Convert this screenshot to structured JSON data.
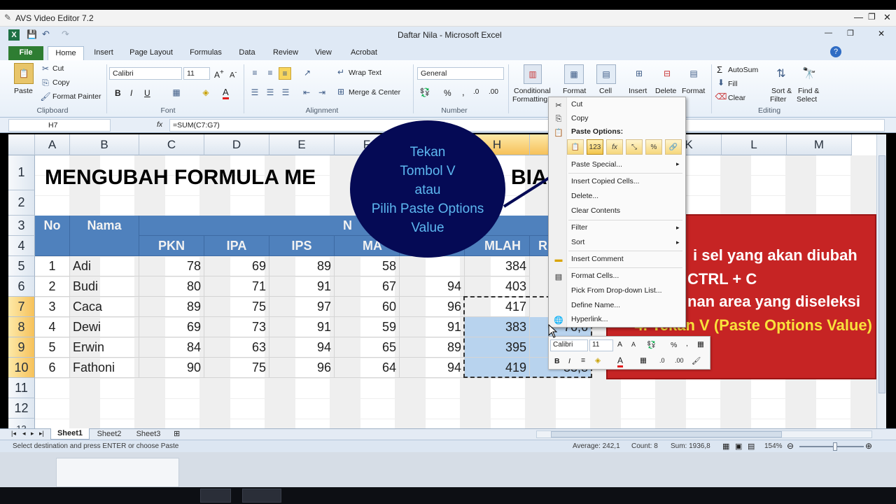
{
  "outer_window": {
    "title": "AVS Video Editor 7.2"
  },
  "excel": {
    "title": "Daftar Nila  -  Microsoft Excel",
    "tabs": [
      "File",
      "Home",
      "Insert",
      "Page Layout",
      "Formulas",
      "Data",
      "Review",
      "View",
      "Acrobat"
    ],
    "active_tab": "Home"
  },
  "ribbon": {
    "clipboard": {
      "paste": "Paste",
      "cut": "Cut",
      "copy": "Copy",
      "format_painter": "Format Painter",
      "label": "Clipboard"
    },
    "font": {
      "name": "Calibri",
      "size": "11",
      "bold": "B",
      "italic": "I",
      "underline": "U",
      "label": "Font"
    },
    "alignment": {
      "wrap": "Wrap Text",
      "merge": "Merge & Center",
      "label": "Alignment"
    },
    "number": {
      "format": "General",
      "percent": "%",
      "comma": ",",
      "label": "Number"
    },
    "styles": {
      "conditional_1": "Conditional",
      "conditional_2": "Formatting",
      "format_1": "Format",
      "cell": "Cell"
    },
    "cells": {
      "insert": "Insert",
      "delete": "Delete",
      "format": "Format"
    },
    "editing": {
      "autosum": "AutoSum",
      "fill": "Fill",
      "clear": "Clear",
      "sort_1": "Sort &",
      "sort_2": "Filter",
      "find_1": "Find &",
      "find_2": "Select",
      "label": "Editing"
    }
  },
  "formula_bar": {
    "name_box": "H7",
    "fx": "fx",
    "formula": "=SUM(C7:G7)"
  },
  "columns": [
    "A",
    "B",
    "C",
    "D",
    "E",
    "F",
    "G",
    "H",
    "I",
    "J",
    "K",
    "L",
    "M"
  ],
  "sheet": {
    "title": "MENGUBAH FORMULA ME",
    "title_tail": "BIA",
    "headers": {
      "no": "No",
      "nama": "Nama",
      "nilai": "N",
      "pkn": "PKN",
      "ipa": "IPA",
      "ips": "IPS",
      "mat": "MA",
      "jumlah": "MLAH",
      "rata": "R"
    },
    "rows": [
      {
        "no": "1",
        "nama": "Adi",
        "pkn": "78",
        "ipa": "69",
        "ips": "89",
        "mat": "58",
        "jumlah": "384"
      },
      {
        "no": "2",
        "nama": "Budi",
        "pkn": "80",
        "ipa": "71",
        "ips": "91",
        "mat": "67",
        "g": "94",
        "jumlah": "403"
      },
      {
        "no": "3",
        "nama": "Caca",
        "pkn": "89",
        "ipa": "75",
        "ips": "97",
        "mat": "60",
        "g": "96",
        "jumlah": "417"
      },
      {
        "no": "4",
        "nama": "Dewi",
        "pkn": "69",
        "ipa": "73",
        "ips": "91",
        "mat": "59",
        "g": "91",
        "jumlah": "383",
        "rata": "76,6"
      },
      {
        "no": "5",
        "nama": "Erwin",
        "pkn": "84",
        "ipa": "63",
        "ips": "94",
        "mat": "65",
        "g": "89",
        "jumlah": "395"
      },
      {
        "no": "6",
        "nama": "Fathoni",
        "pkn": "90",
        "ipa": "75",
        "ips": "96",
        "mat": "64",
        "g": "94",
        "jumlah": "419",
        "rata": "83,8"
      }
    ]
  },
  "callout": {
    "line1": "Tekan",
    "line2": "Tombol V",
    "line3": "atau",
    "line4": "Pilih Paste Options",
    "line5": "Value"
  },
  "context_menu": {
    "cut": "Cut",
    "copy": "Copy",
    "paste_options": "Paste Options:",
    "paste_special": "Paste Special...",
    "insert_copied": "Insert Copied Cells...",
    "delete": "Delete...",
    "clear": "Clear Contents",
    "filter": "Filter",
    "sort": "Sort",
    "insert_comment": "Insert Comment",
    "format_cells": "Format Cells...",
    "pick_list": "Pick From Drop-down List...",
    "define_name": "Define Name...",
    "hyperlink": "Hyperlink..."
  },
  "mini_toolbar": {
    "font": "Calibri",
    "size": "11"
  },
  "instructions": {
    "line1": "i sel yang akan diubah",
    "line2": "CTRL + C",
    "line3": "nan area yang diseleksi",
    "line4": "4. Tekan V (Paste Options Value)"
  },
  "sheet_tabs": [
    "Sheet1",
    "Sheet2",
    "Sheet3"
  ],
  "status": {
    "message": "Select destination and press ENTER or choose Paste",
    "average": "Average: 242,1",
    "count": "Count: 8",
    "sum": "Sum: 1936,8",
    "zoom": "154%"
  },
  "colors": {
    "header_blue": "#4f81bd",
    "selection": "#b8d3ee",
    "circle": "#050a55",
    "red_box": "#c62424",
    "callout_text": "#5db8f0"
  }
}
